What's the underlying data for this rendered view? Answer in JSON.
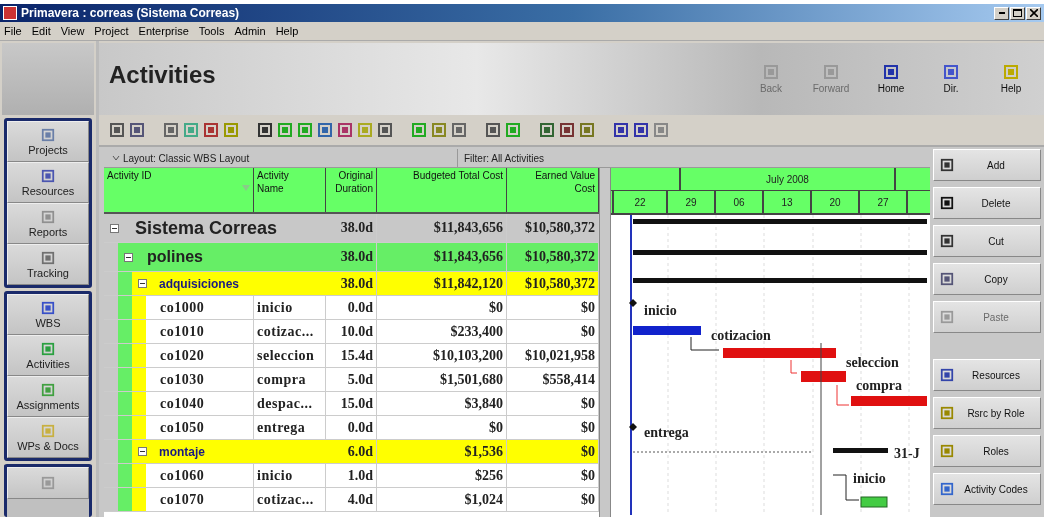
{
  "window": {
    "title": "Primavera : correas (Sistema Correas)"
  },
  "menu": [
    "File",
    "Edit",
    "View",
    "Project",
    "Enterprise",
    "Tools",
    "Admin",
    "Help"
  ],
  "sidebar": {
    "groups": [
      {
        "items": [
          "Projects",
          "Resources",
          "Reports",
          "Tracking"
        ]
      },
      {
        "items": [
          "WBS",
          "Activities",
          "Assignments",
          "WPs & Docs"
        ]
      }
    ]
  },
  "page_title": "Activities",
  "nav_buttons": [
    {
      "label": "Back",
      "disabled": true
    },
    {
      "label": "Forward",
      "disabled": true
    },
    {
      "label": "Home",
      "disabled": false
    },
    {
      "label": "Dir.",
      "disabled": false
    },
    {
      "label": "Help",
      "disabled": false
    }
  ],
  "layout_bar": {
    "layout": "Layout: Classic WBS Layout",
    "filter": "Filter: All Activities"
  },
  "table": {
    "columns": [
      "Activity ID",
      "Activity Name",
      "Original Duration",
      "Budgeted Total Cost",
      "Earned Value Cost"
    ],
    "rows": [
      {
        "kind": "project",
        "name": "Sistema Correas",
        "expanded": true,
        "duration": "38.0d",
        "budget": "$11,843,656",
        "earned": "$10,580,372",
        "children": [
          {
            "kind": "wbs",
            "name": "polines",
            "expanded": true,
            "duration": "38.0d",
            "budget": "$11,843,656",
            "earned": "$10,580,372",
            "children": [
              {
                "kind": "wbs",
                "name": "adquisiciones",
                "expanded": true,
                "duration": "38.0d",
                "budget": "$11,842,120",
                "earned": "$10,580,372",
                "children": [
                  {
                    "kind": "activity",
                    "id": "co1000",
                    "name": "inicio",
                    "duration": "0.0d",
                    "budget": "$0",
                    "earned": "$0"
                  },
                  {
                    "kind": "activity",
                    "id": "co1010",
                    "name": "cotizac...",
                    "duration": "10.0d",
                    "budget": "$233,400",
                    "earned": "$0"
                  },
                  {
                    "kind": "activity",
                    "id": "co1020",
                    "name": "seleccion",
                    "duration": "15.4d",
                    "budget": "$10,103,200",
                    "earned": "$10,021,958"
                  },
                  {
                    "kind": "activity",
                    "id": "co1030",
                    "name": "compra",
                    "duration": "5.0d",
                    "budget": "$1,501,680",
                    "earned": "$558,414"
                  },
                  {
                    "kind": "activity",
                    "id": "co1040",
                    "name": "despac...",
                    "duration": "15.0d",
                    "budget": "$3,840",
                    "earned": "$0"
                  },
                  {
                    "kind": "activity",
                    "id": "co1050",
                    "name": "entrega",
                    "duration": "0.0d",
                    "budget": "$0",
                    "earned": "$0"
                  }
                ]
              },
              {
                "kind": "wbs",
                "name": "montaje",
                "expanded": true,
                "duration": "6.0d",
                "budget": "$1,536",
                "earned": "$0",
                "children": [
                  {
                    "kind": "activity",
                    "id": "co1060",
                    "name": "inicio",
                    "duration": "1.0d",
                    "budget": "$256",
                    "earned": "$0"
                  },
                  {
                    "kind": "activity",
                    "id": "co1070",
                    "name": "cotizac...",
                    "duration": "4.0d",
                    "budget": "$1,024",
                    "earned": "$0"
                  }
                ]
              }
            ]
          }
        ]
      }
    ]
  },
  "gantt": {
    "month": "July 2008",
    "days": [
      "22",
      "29",
      "06",
      "13",
      "20",
      "27"
    ],
    "labels": [
      "inicio",
      "cotizacion",
      "seleccion",
      "compra",
      "entrega",
      "31-J",
      "inicio"
    ]
  },
  "edit_buttons": [
    {
      "label": "Add",
      "disabled": false
    },
    {
      "label": "Delete",
      "disabled": false
    },
    {
      "label": "Cut",
      "disabled": false
    },
    {
      "label": "Copy",
      "disabled": false
    },
    {
      "label": "Paste",
      "disabled": true
    }
  ],
  "assign_buttons": [
    {
      "label": "Resources",
      "disabled": false
    },
    {
      "label": "Rsrc by Role",
      "disabled": false
    },
    {
      "label": "Roles",
      "disabled": false
    },
    {
      "label": "Activity Codes",
      "disabled": false
    }
  ]
}
